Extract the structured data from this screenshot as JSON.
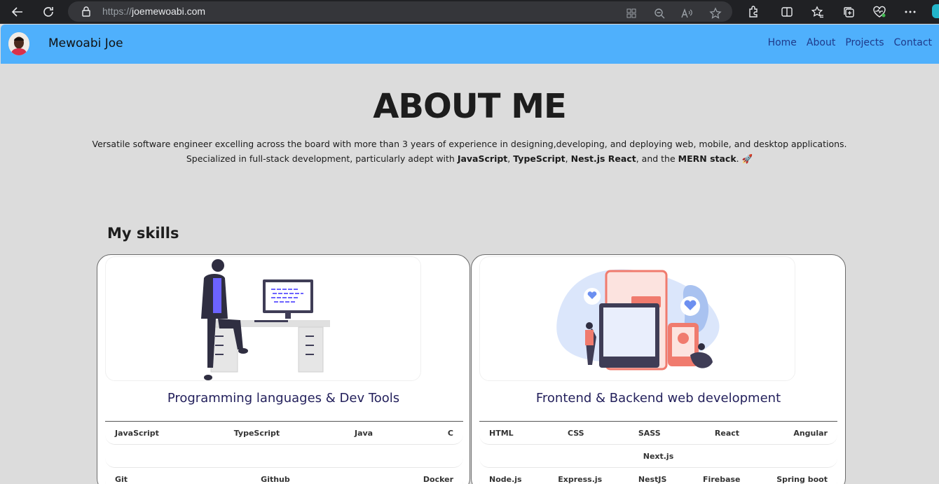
{
  "browser": {
    "url_scheme": "https://",
    "url_host": "joemewoabi.com"
  },
  "header": {
    "brand": "Mewoabi Joe",
    "nav": [
      "Home",
      "About",
      "Projects",
      "Contact"
    ]
  },
  "about": {
    "title": "ABOUT ME",
    "line1": "Versatile software engineer excelling across the board with more than 3 years of experience in designing,developing, and deploying web, mobile, and desktop applications.",
    "line2_prefix": "Specialized in full-stack development, particularly adept with ",
    "js": "JavaScript",
    "comma1": ", ",
    "ts": "TypeScript",
    "comma2": ", ",
    "nest_react": "Nest.js React",
    "and_the": ", and the ",
    "mern": "MERN stack",
    "suffix": ". 🚀"
  },
  "skills": {
    "heading": "My skills",
    "cards": [
      {
        "title": "Programming languages & Dev Tools",
        "rows": [
          [
            "JavaScript",
            "TypeScript",
            "Java",
            "C"
          ],
          [],
          [
            "Git",
            "Github",
            "Docker"
          ]
        ]
      },
      {
        "title": "Frontend & Backend web development",
        "rows": [
          [
            "HTML",
            "CSS",
            "SASS",
            "React",
            "Angular"
          ],
          [
            "Next.js"
          ],
          [
            "Node.js",
            "Express.js",
            "NestJS",
            "Firebase",
            "Spring boot"
          ]
        ]
      }
    ]
  },
  "colors": {
    "header_bg": "#4fb0fc",
    "page_bg": "#dcdcdc",
    "nav_link": "#1f3a8a",
    "card_title": "#24215c"
  }
}
